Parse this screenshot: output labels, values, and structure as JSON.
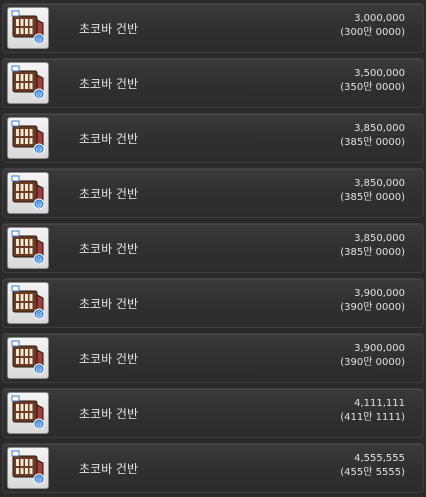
{
  "items": [
    {
      "name": "초코바 건반",
      "price": "3,000,000",
      "price_korean": "(300만 0000)",
      "icon": "chocobar-keyboard-icon"
    },
    {
      "name": "초코바 건반",
      "price": "3,500,000",
      "price_korean": "(350만 0000)",
      "icon": "chocobar-keyboard-icon"
    },
    {
      "name": "초코바 건반",
      "price": "3,850,000",
      "price_korean": "(385만 0000)",
      "icon": "chocobar-keyboard-icon"
    },
    {
      "name": "초코바 건반",
      "price": "3,850,000",
      "price_korean": "(385만 0000)",
      "icon": "chocobar-keyboard-icon"
    },
    {
      "name": "초코바 건반",
      "price": "3,850,000",
      "price_korean": "(385만 0000)",
      "icon": "chocobar-keyboard-icon"
    },
    {
      "name": "초코바 건반",
      "price": "3,900,000",
      "price_korean": "(390만 0000)",
      "icon": "chocobar-keyboard-icon"
    },
    {
      "name": "초코바 건반",
      "price": "3,900,000",
      "price_korean": "(390만 0000)",
      "icon": "chocobar-keyboard-icon"
    },
    {
      "name": "초코바 건반",
      "price": "4,111,111",
      "price_korean": "(411만 1111)",
      "icon": "chocobar-keyboard-icon"
    },
    {
      "name": "초코바 건반",
      "price": "4,555,555",
      "price_korean": "(455만 5555)",
      "icon": "chocobar-keyboard-icon"
    }
  ]
}
